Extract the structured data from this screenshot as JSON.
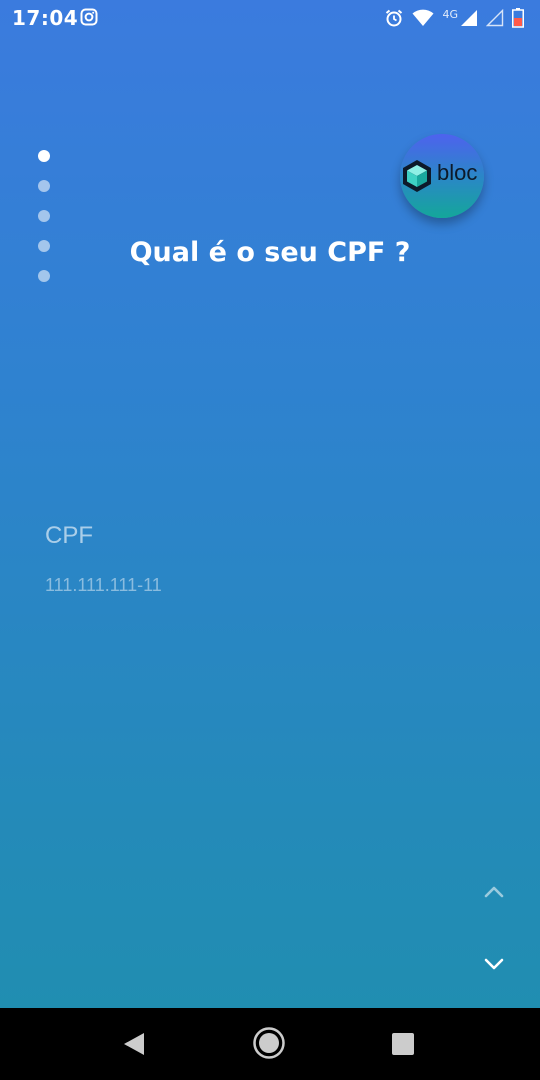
{
  "status_bar": {
    "time": "17:04",
    "network_label": "4G",
    "icons": [
      "instagram-icon",
      "alarm-icon",
      "wifi-icon",
      "signal-icon",
      "signal-icon",
      "battery-icon"
    ]
  },
  "onboarding": {
    "pages_total": 5,
    "active_page": 1
  },
  "logo": {
    "text": "bloc",
    "icon": "cube-icon"
  },
  "question": {
    "title": "Qual é o seu CPF ?"
  },
  "cpf_field": {
    "label": "CPF",
    "value": "",
    "placeholder": "111.111.111-11"
  },
  "navigation": {
    "up_icon": "chevron-up-icon",
    "down_icon": "chevron-down-icon"
  },
  "system_nav": {
    "buttons": [
      "back-icon",
      "home-icon",
      "recents-icon"
    ]
  },
  "colors": {
    "background_top": "#3b7bde",
    "background_bottom": "#1f8fae",
    "logo_top": "#4e62ee",
    "logo_bottom": "#14a79a"
  }
}
